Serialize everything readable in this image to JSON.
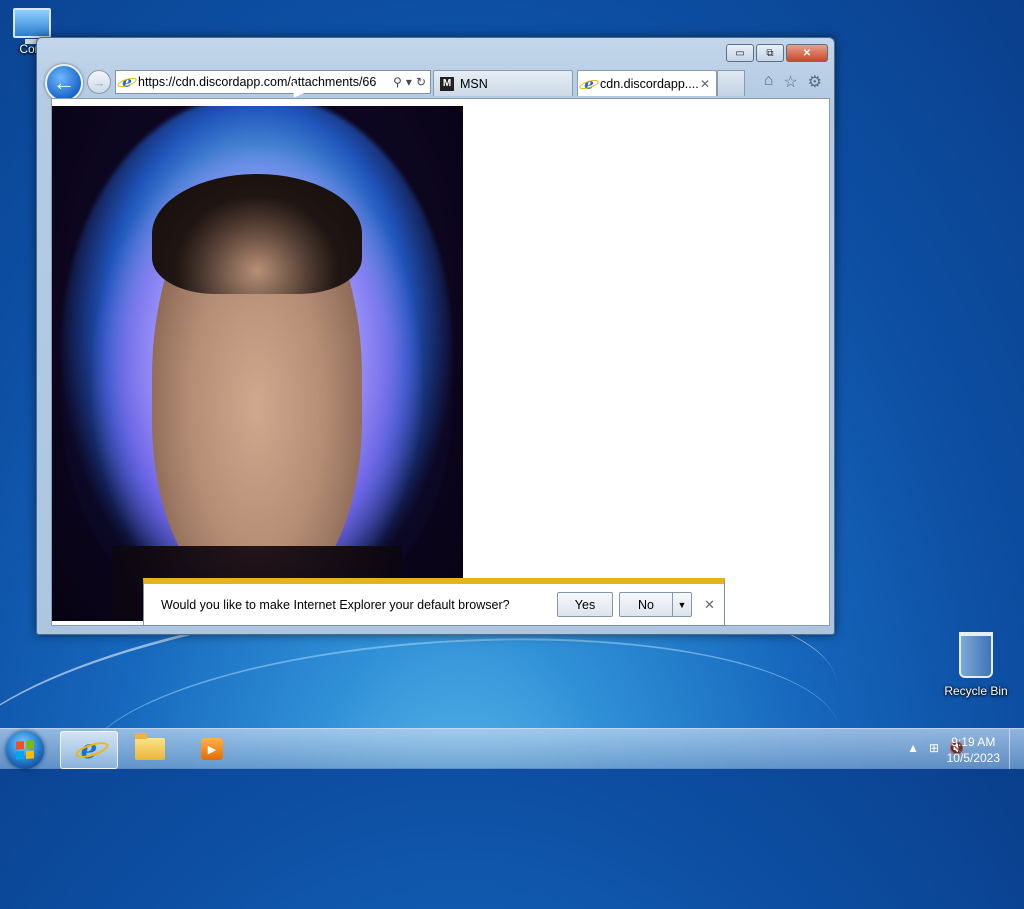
{
  "desktop": {
    "computer_label": "Com",
    "recycle_label": "Recycle Bin"
  },
  "browser": {
    "caption": {
      "minimize": "▭",
      "restore": "⧉",
      "close": "✕"
    },
    "address_url": "https://cdn.discordapp.com/attachments/66",
    "tabs": [
      {
        "label": "MSN"
      },
      {
        "label": "cdn.discordapp...."
      }
    ],
    "tab_close": "✕",
    "icons": {
      "home": "⌂",
      "favorites": "☆",
      "tools": "⚙",
      "search": "⚲",
      "dropdown": "▾",
      "refresh": "↻",
      "back": "←",
      "forward": "→"
    }
  },
  "notification": {
    "message": "Would you like to make Internet Explorer your default browser?",
    "yes": "Yes",
    "no": "No",
    "dropdown": "▼",
    "close": "✕"
  },
  "taskbar": {
    "time": "9:19 AM",
    "date": "10/5/2023",
    "tray_up": "▲",
    "network": "⊞",
    "volume": "🔇"
  },
  "colors": {
    "notify_bar": "#e6b416",
    "accent": "#1a66c9"
  }
}
